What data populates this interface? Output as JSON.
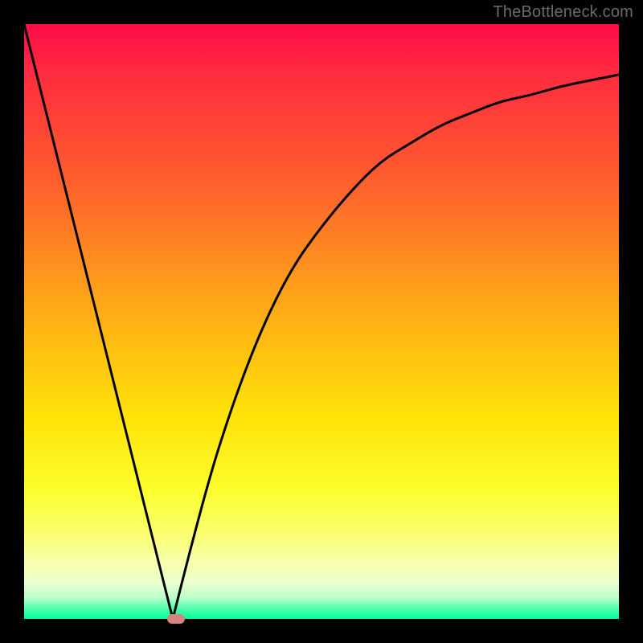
{
  "watermark": "TheBottleneck.com",
  "colors": {
    "frame": "#000000",
    "curve": "#000000",
    "marker": "#d4847e",
    "gradient_top": "#ff0b48",
    "gradient_bottom": "#00ff9a"
  },
  "chart_data": {
    "type": "line",
    "title": "",
    "xlabel": "",
    "ylabel": "",
    "xlim": [
      0,
      100
    ],
    "ylim": [
      0,
      100
    ],
    "grid": false,
    "legend": false,
    "description": "Bottleneck-style V-curve on a red-to-green vertical gradient. Left branch is a straight segment descending from the top-left corner to the minimum near the bottom; right branch rises from the same minimum and asymptotically approaches a high value toward the right edge. A small rounded marker sits at the minimum.",
    "series": [
      {
        "name": "left-branch",
        "type": "line",
        "x": [
          0,
          25
        ],
        "y": [
          100,
          0
        ]
      },
      {
        "name": "right-branch",
        "type": "line",
        "x": [
          25,
          30,
          35,
          40,
          45,
          50,
          55,
          60,
          65,
          70,
          75,
          80,
          85,
          90,
          95,
          100
        ],
        "y": [
          0,
          20,
          36,
          49,
          59,
          66,
          72,
          77,
          80,
          83,
          85,
          87,
          88,
          89.5,
          90.5,
          91.5
        ]
      }
    ],
    "marker": {
      "x": 25.5,
      "y": 0,
      "width": 3.0,
      "height": 1.6
    }
  }
}
